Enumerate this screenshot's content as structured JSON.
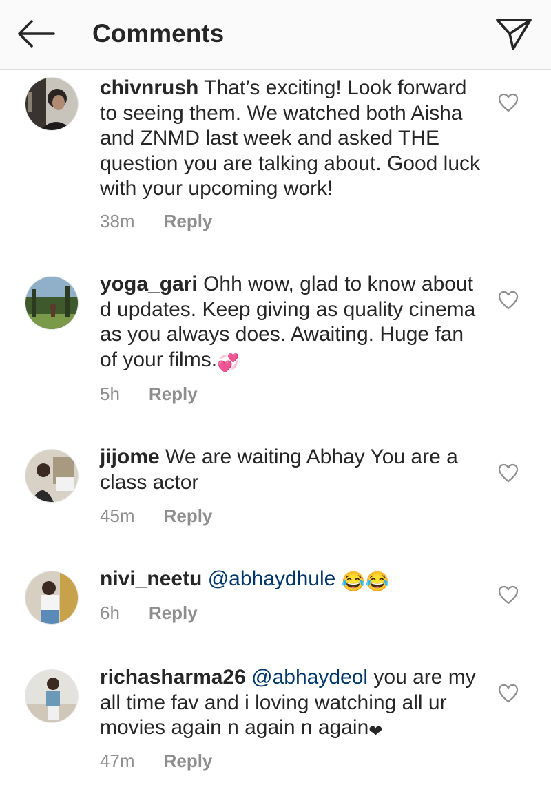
{
  "header": {
    "title": "Comments",
    "back_icon": "arrow-left-icon",
    "send_icon": "paper-plane-icon"
  },
  "colors": {
    "text": "#262626",
    "secondary": "#8e8e8e",
    "mention": "#00376b",
    "header_bg": "#fafafa"
  },
  "comments": [
    {
      "username": "chivnrush",
      "text": "That’s exciting! Look forward to seeing them. We watched both Aisha and ZNMD last week and asked THE question you are talking about. Good luck with your upcoming work!",
      "time": "38m",
      "reply_label": "Reply"
    },
    {
      "username": "yoga_gari",
      "text": "Ohh wow, glad to know about d updates. Keep giving as quality cinema as you always does. Awaiting. Huge fan of your films.",
      "emoji": "💞",
      "time": "5h",
      "reply_label": "Reply"
    },
    {
      "username": "jijome",
      "text": "We are waiting Abhay You are a class actor",
      "time": "45m",
      "reply_label": "Reply"
    },
    {
      "username": "nivi_neetu",
      "mention": "@abhaydhule",
      "emoji": "😂😂",
      "time": "6h",
      "reply_label": "Reply"
    },
    {
      "username": "richasharma26",
      "mention": "@abhaydeol",
      "text": " you are my all time fav and i loving watching all ur movies again n again n again",
      "emoji": "❤",
      "time": "47m",
      "reply_label": "Reply"
    }
  ]
}
